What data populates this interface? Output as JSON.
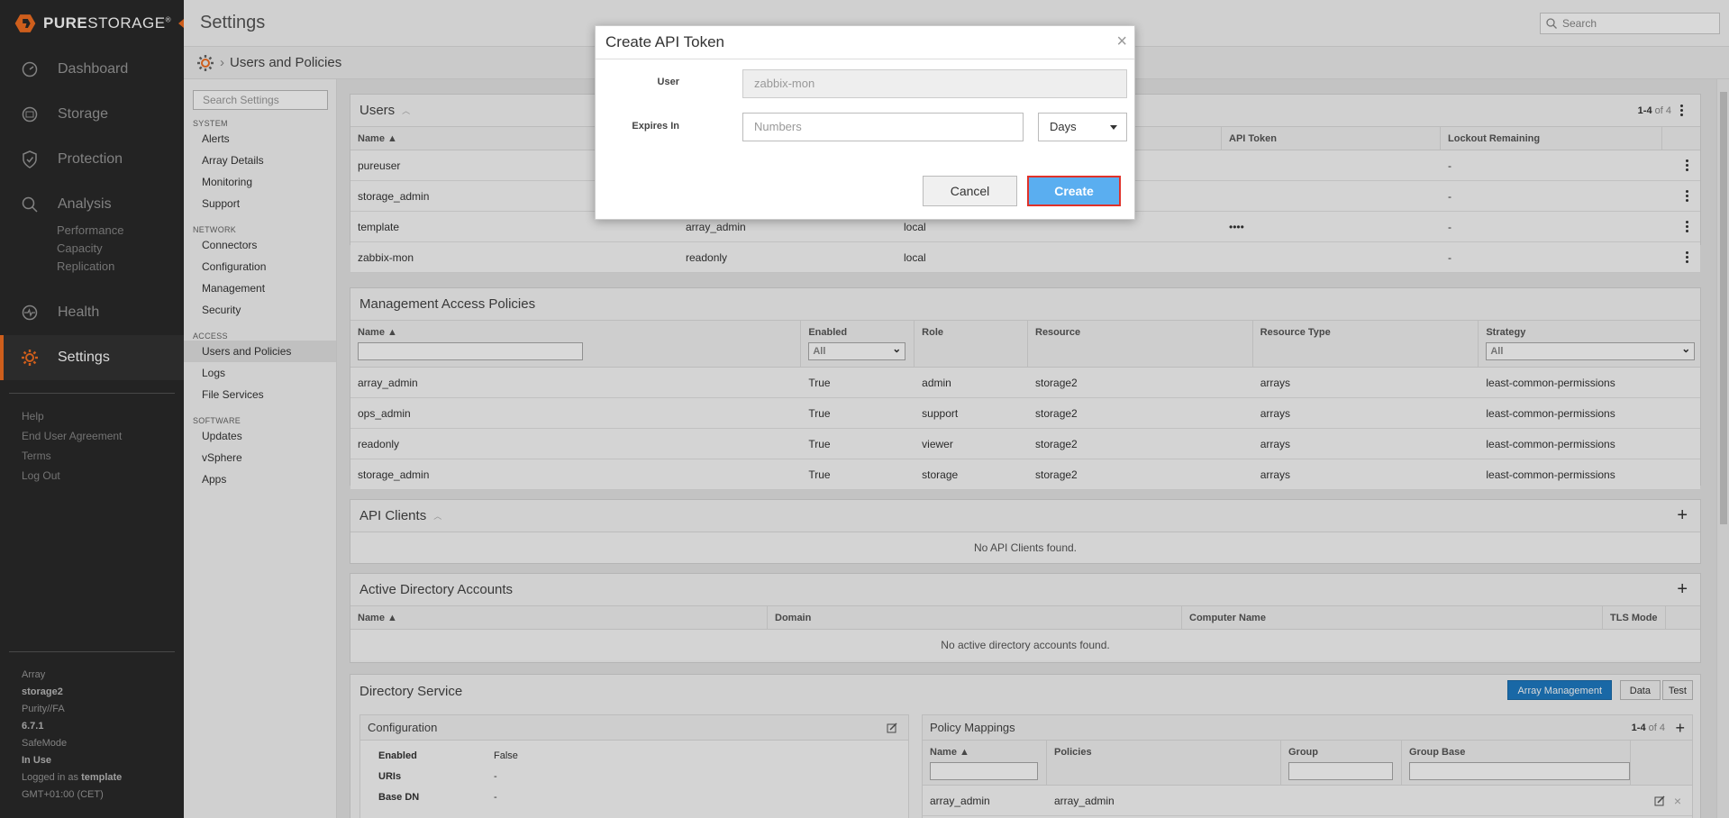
{
  "brand": {
    "name_bold": "PURE",
    "name_light": "STORAGE",
    "mark": "®"
  },
  "nav": {
    "items": [
      {
        "label": "Dashboard",
        "icon": "dashboard-icon"
      },
      {
        "label": "Storage",
        "icon": "storage-icon"
      },
      {
        "label": "Protection",
        "icon": "shield-icon"
      },
      {
        "label": "Analysis",
        "icon": "magnifier-icon"
      },
      {
        "label": "Health",
        "icon": "heart-pulse-icon"
      },
      {
        "label": "Settings",
        "icon": "gear-icon"
      }
    ],
    "analysis_sub": [
      "Performance",
      "Capacity",
      "Replication"
    ],
    "links": [
      "Help",
      "End User Agreement",
      "Terms",
      "Log Out"
    ],
    "footer": {
      "array_label": "Array",
      "array_value": "storage2",
      "purity_label": "Purity//FA",
      "purity_value": "6.7.1",
      "safemode_label": "SafeMode",
      "safemode_value": "In Use",
      "logged_prefix": "Logged in as",
      "logged_user": "template",
      "timezone": "GMT+01:00 (CET)"
    }
  },
  "header": {
    "title": "Settings",
    "search_placeholder": "Search",
    "breadcrumb": "Users and Policies"
  },
  "settings_sidebar": {
    "search_placeholder": "Search Settings",
    "system_head": "SYSTEM",
    "system_items": [
      "Alerts",
      "Array Details",
      "Monitoring",
      "Support"
    ],
    "network_head": "NETWORK",
    "network_items": [
      "Connectors",
      "Configuration",
      "Management",
      "Security"
    ],
    "access_head": "ACCESS",
    "access_items": [
      "Users and Policies",
      "Logs",
      "File Services"
    ],
    "software_head": "SOFTWARE",
    "software_items": [
      "Updates",
      "vSphere",
      "Apps"
    ]
  },
  "users": {
    "title": "Users",
    "count": "1-4",
    "count_of": "of 4",
    "columns": [
      "Name ▲",
      "",
      "",
      "API Token",
      "Lockout Remaining"
    ],
    "rows": [
      {
        "name": "pureuser",
        "role": "",
        "type": "",
        "token": "",
        "lockout": "-"
      },
      {
        "name": "storage_admin",
        "role": "",
        "type": "",
        "token": "",
        "lockout": "-"
      },
      {
        "name": "template",
        "role": "array_admin",
        "type": "local",
        "token": "••••",
        "lockout": "-"
      },
      {
        "name": "zabbix-mon",
        "role": "readonly",
        "type": "local",
        "token": "",
        "lockout": "-"
      }
    ]
  },
  "policies": {
    "title": "Management Access Policies",
    "columns": [
      "Name ▲",
      "Enabled",
      "Role",
      "Resource",
      "Resource Type",
      "Strategy"
    ],
    "filter_all": "All",
    "rows": [
      [
        "array_admin",
        "True",
        "admin",
        "storage2",
        "arrays",
        "least-common-permissions"
      ],
      [
        "ops_admin",
        "True",
        "support",
        "storage2",
        "arrays",
        "least-common-permissions"
      ],
      [
        "readonly",
        "True",
        "viewer",
        "storage2",
        "arrays",
        "least-common-permissions"
      ],
      [
        "storage_admin",
        "True",
        "storage",
        "storage2",
        "arrays",
        "least-common-permissions"
      ]
    ]
  },
  "api_clients": {
    "title": "API Clients",
    "empty": "No API Clients found."
  },
  "ad_accounts": {
    "title": "Active Directory Accounts",
    "columns": [
      "Name ▲",
      "Domain",
      "Computer Name",
      "TLS Mode"
    ],
    "empty": "No active directory accounts found."
  },
  "directory_service": {
    "title": "Directory Service",
    "tabs": [
      "Array Management",
      "Data"
    ],
    "test_label": "Test",
    "config_title": "Configuration",
    "config_rows": [
      [
        "Enabled",
        "False"
      ],
      [
        "URIs",
        "-"
      ],
      [
        "Base DN",
        "-"
      ]
    ],
    "mappings_title": "Policy Mappings",
    "mappings_count": "1-4",
    "mappings_of": "of 4",
    "mappings_columns": [
      "Name ▲",
      "Policies",
      "Group",
      "Group Base"
    ],
    "mappings_row": [
      "array_admin",
      "array_admin"
    ]
  },
  "modal": {
    "title": "Create API Token",
    "user_label": "User",
    "user_value": "zabbix-mon",
    "expires_label": "Expires In",
    "expires_placeholder": "Numbers",
    "unit_value": "Days",
    "cancel": "Cancel",
    "create": "Create"
  },
  "colors": {
    "accent": "#f36f21",
    "primary_button": "#5aaef0",
    "highlight_border": "#e0322a",
    "tab_active": "#1e7bc4"
  }
}
